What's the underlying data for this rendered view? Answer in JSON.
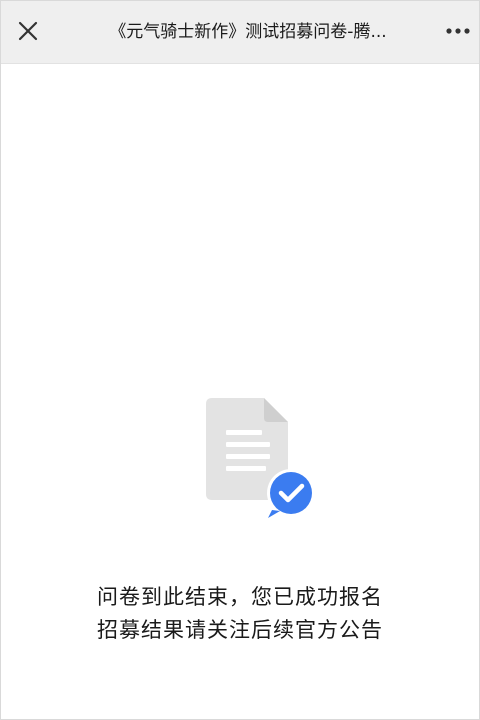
{
  "header": {
    "title": "《元气骑士新作》测试招募问卷-腾...",
    "close_icon": "close-icon",
    "more_icon": "more-icon"
  },
  "main": {
    "illustration": {
      "icon": "document-check-icon",
      "check_color": "#3b7cf0",
      "doc_color": "#e6e6e6"
    },
    "message_line1": "问卷到此结束，您已成功报名",
    "message_line2": "招募结果请关注后续官方公告"
  },
  "colors": {
    "topbar_bg": "#efefef",
    "accent": "#3b7cf0"
  }
}
